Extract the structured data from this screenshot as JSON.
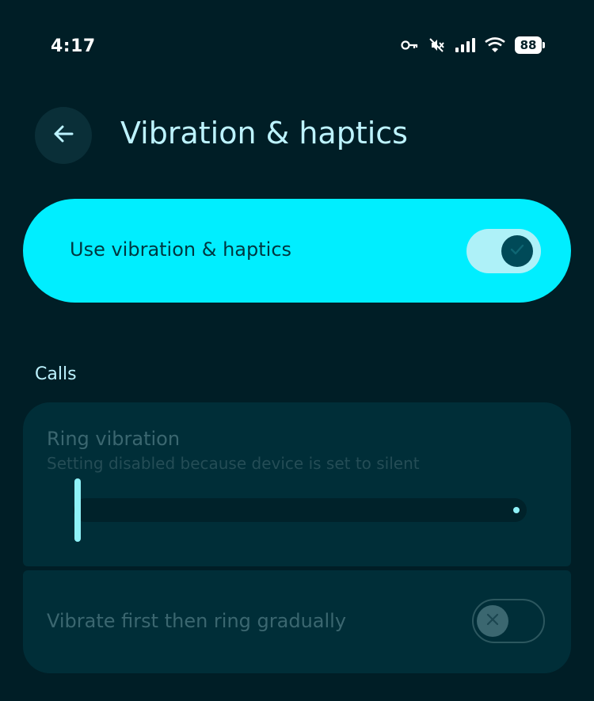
{
  "status_bar": {
    "time": "4:17",
    "battery_level": "88",
    "icons": [
      "vpn-key-icon",
      "silent-mode-icon",
      "cellular-signal-icon",
      "wifi-icon",
      "battery-icon"
    ]
  },
  "header": {
    "back_icon": "arrow-left-icon",
    "title": "Vibration & haptics"
  },
  "master_switch": {
    "label": "Use vibration & haptics",
    "state": "on",
    "color": "#00eeff"
  },
  "sections": {
    "calls": {
      "header": "Calls",
      "ring_vibration": {
        "title": "Ring vibration",
        "subtitle": "Setting disabled because device is set to silent",
        "level": 0,
        "disabled": true
      },
      "vibrate_first": {
        "label": "Vibrate first then ring gradually",
        "state": "off",
        "disabled": true
      }
    }
  }
}
